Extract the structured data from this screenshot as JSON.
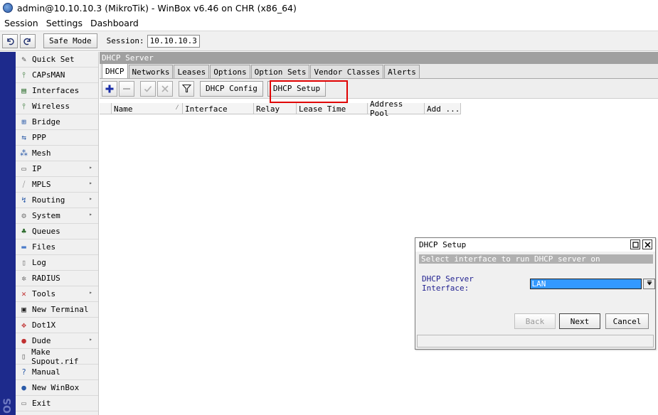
{
  "window": {
    "title": "admin@10.10.10.3 (MikroTik) - WinBox v6.46 on CHR (x86_64)"
  },
  "menu": [
    "Session",
    "Settings",
    "Dashboard"
  ],
  "toolbar": {
    "undo_icon": "undo-icon",
    "redo_icon": "redo-icon",
    "safe_mode_label": "Safe Mode",
    "session_label": "Session:",
    "session_value": "10.10.10.3"
  },
  "sidebar": {
    "brand_vertical": "OS",
    "items": [
      {
        "label": "Quick Set",
        "icon": "quick-set-icon",
        "glyph": "✎",
        "submenu": false
      },
      {
        "label": "CAPsMAN",
        "icon": "capsman-icon",
        "glyph": "⫯",
        "submenu": false
      },
      {
        "label": "Interfaces",
        "icon": "interfaces-icon",
        "glyph": "▤",
        "submenu": false
      },
      {
        "label": "Wireless",
        "icon": "wireless-icon",
        "glyph": "⫯",
        "submenu": false
      },
      {
        "label": "Bridge",
        "icon": "bridge-icon",
        "glyph": "⊞",
        "submenu": false
      },
      {
        "label": "PPP",
        "icon": "ppp-icon",
        "glyph": "⇆",
        "submenu": false
      },
      {
        "label": "Mesh",
        "icon": "mesh-icon",
        "glyph": "⁂",
        "submenu": false
      },
      {
        "label": "IP",
        "icon": "ip-icon",
        "glyph": "▭",
        "submenu": true
      },
      {
        "label": "MPLS",
        "icon": "mpls-icon",
        "glyph": "⧸",
        "submenu": true
      },
      {
        "label": "Routing",
        "icon": "routing-icon",
        "glyph": "↯",
        "submenu": true
      },
      {
        "label": "System",
        "icon": "system-icon",
        "glyph": "⚙",
        "submenu": true
      },
      {
        "label": "Queues",
        "icon": "queues-icon",
        "glyph": "♣",
        "submenu": false
      },
      {
        "label": "Files",
        "icon": "files-icon",
        "glyph": "▬",
        "submenu": false
      },
      {
        "label": "Log",
        "icon": "log-icon",
        "glyph": "▯",
        "submenu": false
      },
      {
        "label": "RADIUS",
        "icon": "radius-icon",
        "glyph": "✲",
        "submenu": false
      },
      {
        "label": "Tools",
        "icon": "tools-icon",
        "glyph": "✕",
        "submenu": true
      },
      {
        "label": "New Terminal",
        "icon": "terminal-icon",
        "glyph": "▣",
        "submenu": false
      },
      {
        "label": "Dot1X",
        "icon": "dot1x-icon",
        "glyph": "✥",
        "submenu": false
      },
      {
        "label": "Dude",
        "icon": "dude-icon",
        "glyph": "●",
        "submenu": true
      },
      {
        "label": "Make Supout.rif",
        "icon": "supout-icon",
        "glyph": "▯",
        "submenu": false
      },
      {
        "label": "Manual",
        "icon": "manual-icon",
        "glyph": "?",
        "submenu": false
      },
      {
        "label": "New WinBox",
        "icon": "winbox-icon",
        "glyph": "●",
        "submenu": false
      },
      {
        "label": "Exit",
        "icon": "exit-icon",
        "glyph": "▭",
        "submenu": false
      }
    ]
  },
  "panel": {
    "title": "DHCP Server",
    "tabs": [
      "DHCP",
      "Networks",
      "Leases",
      "Options",
      "Option Sets",
      "Vendor Classes",
      "Alerts"
    ],
    "active_tab": "DHCP",
    "actions": {
      "add_icon": "plus-icon",
      "remove_icon": "minus-icon",
      "enable_icon": "check-icon",
      "disable_icon": "x-icon",
      "filter_icon": "filter-icon",
      "dhcp_config_label": "DHCP Config",
      "dhcp_setup_label": "DHCP Setup"
    },
    "columns": [
      "Name",
      "Interface",
      "Relay",
      "Lease Time",
      "Address Pool",
      "Add ..."
    ]
  },
  "dialog": {
    "title": "DHCP Setup",
    "hint": "Select interface to run DHCP server on",
    "field_label": "DHCP Server Interface:",
    "field_value": "LAN",
    "back_label": "Back",
    "next_label": "Next",
    "cancel_label": "Cancel"
  },
  "colors": {
    "sidebar_strip": "#1d2a8c",
    "selection": "#3399ff",
    "highlight": "#e00000",
    "add_icon": "#1a2ea8"
  }
}
